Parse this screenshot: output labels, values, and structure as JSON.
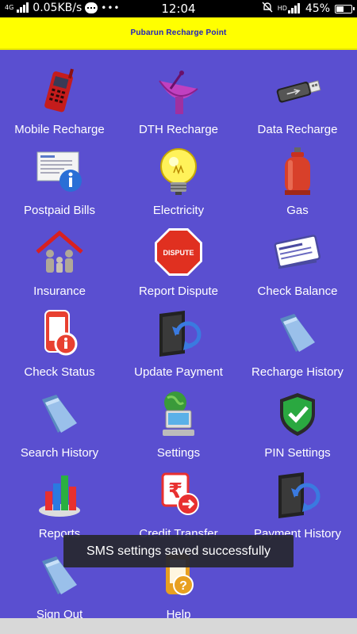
{
  "status": {
    "network_label": "4G",
    "speed": "0.05KB/s",
    "time": "12:04",
    "hd_label": "HD",
    "battery": "45%"
  },
  "header": {
    "title": "Pubarun Recharge Point",
    "bg_color": "#ffff00",
    "title_color": "#2222bb"
  },
  "grid": {
    "bg_color": "#5a4fd0",
    "items": [
      {
        "label": "Mobile Recharge",
        "icon": "mobile-phone-icon"
      },
      {
        "label": "DTH Recharge",
        "icon": "satellite-dish-icon"
      },
      {
        "label": "Data Recharge",
        "icon": "usb-drive-icon"
      },
      {
        "label": "Postpaid Bills",
        "icon": "bill-info-icon"
      },
      {
        "label": "Electricity",
        "icon": "light-bulb-icon"
      },
      {
        "label": "Gas",
        "icon": "gas-cylinder-icon"
      },
      {
        "label": "Insurance",
        "icon": "family-house-icon"
      },
      {
        "label": "Report Dispute",
        "icon": "dispute-stop-sign-icon",
        "badge": "DISPUTE"
      },
      {
        "label": "Check Balance",
        "icon": "cheque-icon"
      },
      {
        "label": "Check Status",
        "icon": "phone-info-icon"
      },
      {
        "label": "Update Payment",
        "icon": "sync-folder-icon"
      },
      {
        "label": "Recharge History",
        "icon": "folder-icon"
      },
      {
        "label": "Search History",
        "icon": "folder-icon"
      },
      {
        "label": "Settings",
        "icon": "computer-globe-icon"
      },
      {
        "label": "PIN Settings",
        "icon": "shield-check-icon"
      },
      {
        "label": "Reports",
        "icon": "bar-chart-icon"
      },
      {
        "label": "Credit Transfer",
        "icon": "rupee-transfer-icon"
      },
      {
        "label": "Payment History",
        "icon": "sync-folder-icon"
      },
      {
        "label": "Sign Out",
        "icon": "folder-icon"
      },
      {
        "label": "Help",
        "icon": "help-phone-icon"
      }
    ]
  },
  "toast": {
    "message": "SMS settings saved successfully"
  }
}
